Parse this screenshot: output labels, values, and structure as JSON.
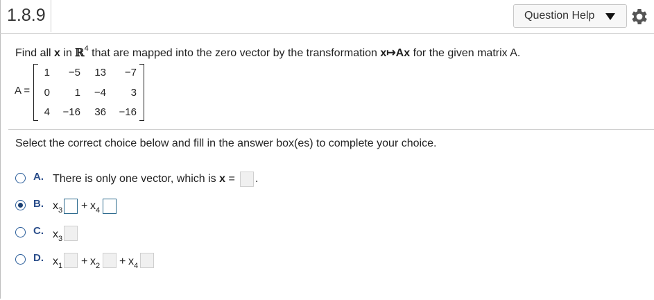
{
  "header": {
    "question_number": "1.8.9",
    "help_label": "Question Help"
  },
  "prompt": {
    "part1": "Find all ",
    "x": "x",
    "part2": " in ",
    "space": "ℝ",
    "space_exp": "4",
    "part3": " that are mapped into the zero vector by the transformation ",
    "map": "x↦Ax",
    "part4": " for the given matrix A."
  },
  "matrix": {
    "label": "A =",
    "rows": [
      [
        "1",
        "−5",
        "13",
        "−7"
      ],
      [
        "0",
        "1",
        "−4",
        "3"
      ],
      [
        "4",
        "−16",
        "36",
        "−16"
      ]
    ]
  },
  "instruction": "Select the correct choice below and fill in the answer box(es) to complete your choice.",
  "choices": {
    "a": {
      "letter": "A.",
      "text": "There is only one vector, which is ",
      "var": "x",
      "eq": " =",
      "period": "."
    },
    "b": {
      "letter": "B.",
      "x3": "x",
      "x3_sub": "3",
      "plus": "+",
      "x4": "x",
      "x4_sub": "4"
    },
    "c": {
      "letter": "C.",
      "x3": "x",
      "x3_sub": "3"
    },
    "d": {
      "letter": "D.",
      "x1": "x",
      "x1_sub": "1",
      "plus1": "+",
      "x2": "x",
      "x2_sub": "2",
      "plus2": "+",
      "x4": "x",
      "x4_sub": "4"
    }
  },
  "selected_choice": "B",
  "colors": {
    "accent": "#2a4d8a",
    "radio_selected": "#1a3f73",
    "active_box": "#2d6b8e",
    "inactive_box": "#f0f0f0"
  }
}
